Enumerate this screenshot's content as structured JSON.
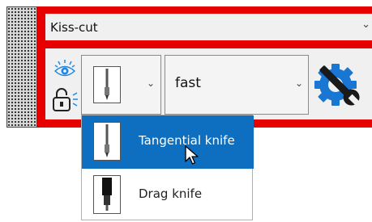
{
  "cut_mode": {
    "selected": "Kiss-cut"
  },
  "knife_select": {
    "selected_index": 0
  },
  "speed_select": {
    "selected": "fast"
  },
  "knife_options": [
    {
      "label": "Tangential knife",
      "icon": "tangential-knife-icon",
      "highlighted": true
    },
    {
      "label": "Drag knife",
      "icon": "drag-knife-icon",
      "highlighted": false
    }
  ],
  "colors": {
    "panel_border": "#e60000",
    "selection_bg": "#0e6fc0",
    "settings_icon_blue": "#1976d2"
  }
}
